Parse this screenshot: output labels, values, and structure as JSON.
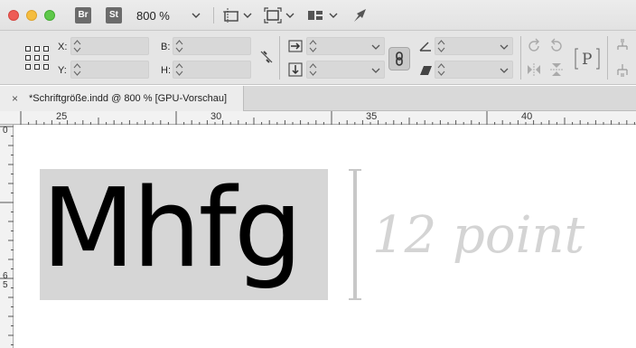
{
  "window": {
    "buttons": [
      "close",
      "minimize",
      "maximize"
    ]
  },
  "toolbar": {
    "bridge_label": "Br",
    "stock_label": "St",
    "zoom_value": "800 %",
    "icons": [
      "view-options-icon",
      "screen-mode-icon",
      "arrange-documents-icon",
      "publish-online-icon"
    ]
  },
  "control_panel": {
    "x_label": "X:",
    "y_label": "Y:",
    "w_label": "B:",
    "h_label": "H:",
    "x_value": "",
    "y_value": "",
    "w_value": "",
    "h_value": ""
  },
  "document_tab": {
    "title": "*Schriftgröße.indd @ 800 % [GPU-Vorschau]",
    "close_glyph": "×"
  },
  "ruler": {
    "h_labels": [
      "25",
      "30",
      "35",
      "40"
    ],
    "v_label_top": "0",
    "v_label_mid_1": "6",
    "v_label_mid_2": "5"
  },
  "canvas": {
    "sample_text": "Mhfg",
    "size_note": "12 point"
  },
  "colors": {
    "highlight": "#d6d6d6",
    "annotation": "#d4d4d4",
    "text": "#000000"
  }
}
